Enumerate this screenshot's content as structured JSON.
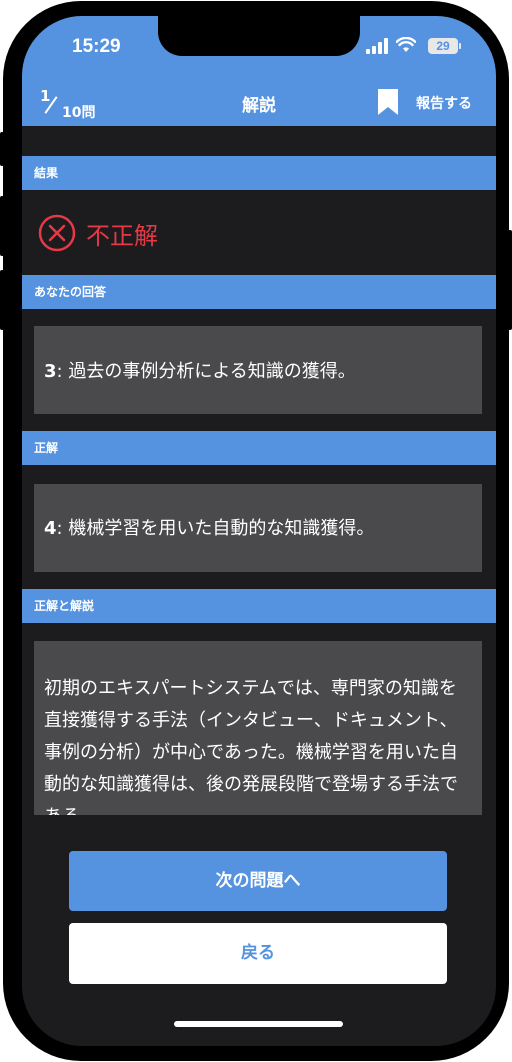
{
  "status_bar": {
    "time": "15:29",
    "battery_level": "29"
  },
  "header": {
    "current_question": "1",
    "total_questions": "10問",
    "title": "解説",
    "report_label": "報告する"
  },
  "result": {
    "section_label": "結果",
    "text": "不正解",
    "color": "#e63946"
  },
  "your_answer": {
    "section_label": "あなたの回答",
    "number": "3",
    "text": ": 過去の事例分析による知識の獲得。"
  },
  "correct_answer": {
    "section_label": "正解",
    "number": "4",
    "text": ": 機械学習を用いた自動的な知識獲得。"
  },
  "explanation": {
    "section_label": "正解と解説",
    "text": "初期のエキスパートシステムでは、専門家の知識を直接獲得する手法（インタビュー、ドキュメント、事例の分析）が中心であった。機械学習を用いた自動的な知識獲得は、後の発展段階で登場する手法である。"
  },
  "buttons": {
    "next_label": "次の問題へ",
    "back_label": "戻る"
  },
  "colors": {
    "accent": "#5593e0",
    "background": "#1c1c1e",
    "card": "#4a4a4c",
    "error": "#e63946"
  },
  "icons": {
    "result": "x-circle-icon",
    "bookmark": "bookmark-icon",
    "signal": "cellular-signal-icon",
    "wifi": "wifi-icon",
    "battery": "battery-icon"
  }
}
